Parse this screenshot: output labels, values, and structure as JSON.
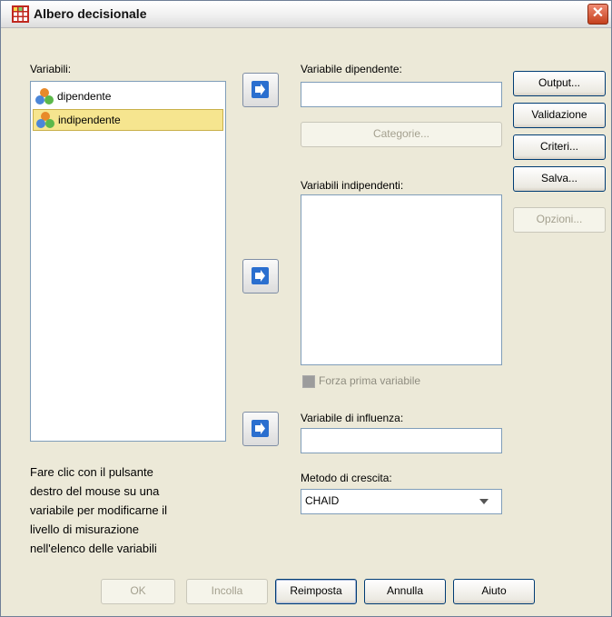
{
  "window": {
    "title": "Albero decisionale",
    "close_icon": "close-icon"
  },
  "variables": {
    "label": "Variabili:",
    "items": [
      {
        "label": "dipendente",
        "icon": "nominal-variable-icon",
        "selected": false
      },
      {
        "label": "indipendente",
        "icon": "nominal-variable-icon",
        "selected": true
      }
    ]
  },
  "help_text": [
    "Fare clic con il pulsante",
    "destro del mouse su una",
    "variabile per modificarne il",
    "livello di misurazione",
    "nell'elenco delle variabili"
  ],
  "dependent": {
    "label": "Variabile dipendente:",
    "value": "",
    "categories_button": "Categorie..."
  },
  "independent": {
    "label": "Variabili indipendenti:",
    "force_first_label": "Forza prima variabile"
  },
  "influence": {
    "label": "Variabile di influenza:",
    "value": ""
  },
  "growth": {
    "label": "Metodo di crescita:",
    "selected": "CHAID"
  },
  "side_buttons": {
    "output": "Output...",
    "validation": "Validazione",
    "criteria": "Criteri...",
    "save": "Salva...",
    "options": "Opzioni..."
  },
  "bottom_buttons": {
    "ok": "OK",
    "paste": "Incolla",
    "reset": "Reimposta",
    "cancel": "Annulla",
    "help": "Aiuto"
  }
}
